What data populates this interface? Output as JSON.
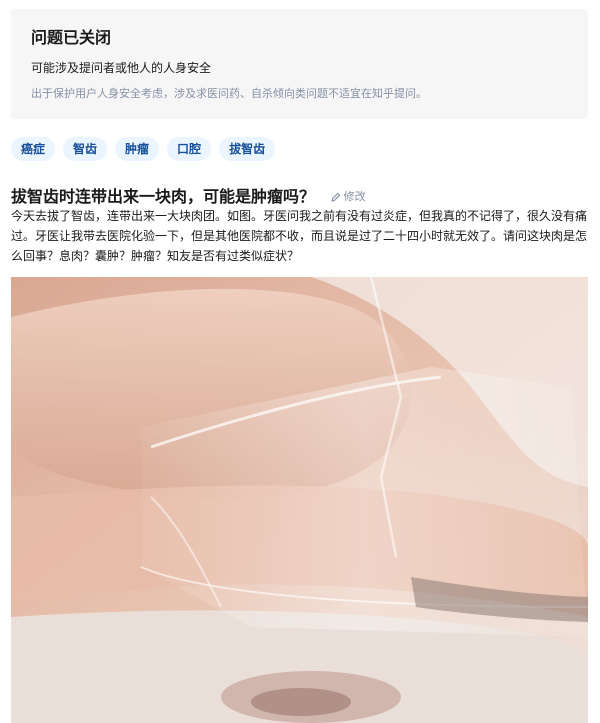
{
  "notice": {
    "title": "问题已关闭",
    "subtitle": "可能涉及提问者或他人的人身安全",
    "description": "出于保护用户人身安全考虑，涉及求医问药、自杀倾向类问题不适宜在知乎提问。"
  },
  "tags": [
    "癌症",
    "智齿",
    "肿瘤",
    "口腔",
    "拔智齿"
  ],
  "question": {
    "title": "拔智齿时连带出来一块肉，可能是肿瘤吗？",
    "edit_label": "修改",
    "body": "今天去拔了智齿，连带出来一大块肉团。如图。牙医问我之前有没有过炎症，但我真的不记得了，很久没有痛过。牙医让我带去医院化验一下，但是其他医院都不收，而且说是过了二十四小时就无效了。请问这块肉是怎么回事？息肉？囊肿？肿瘤？知友是否有过类似症状？"
  },
  "colors": {
    "tag_bg": "#ebf5ff",
    "tag_text": "#175199",
    "notice_bg": "#f6f6f6",
    "muted_text": "#8590a6"
  },
  "icons": {
    "edit": "pencil-icon"
  }
}
